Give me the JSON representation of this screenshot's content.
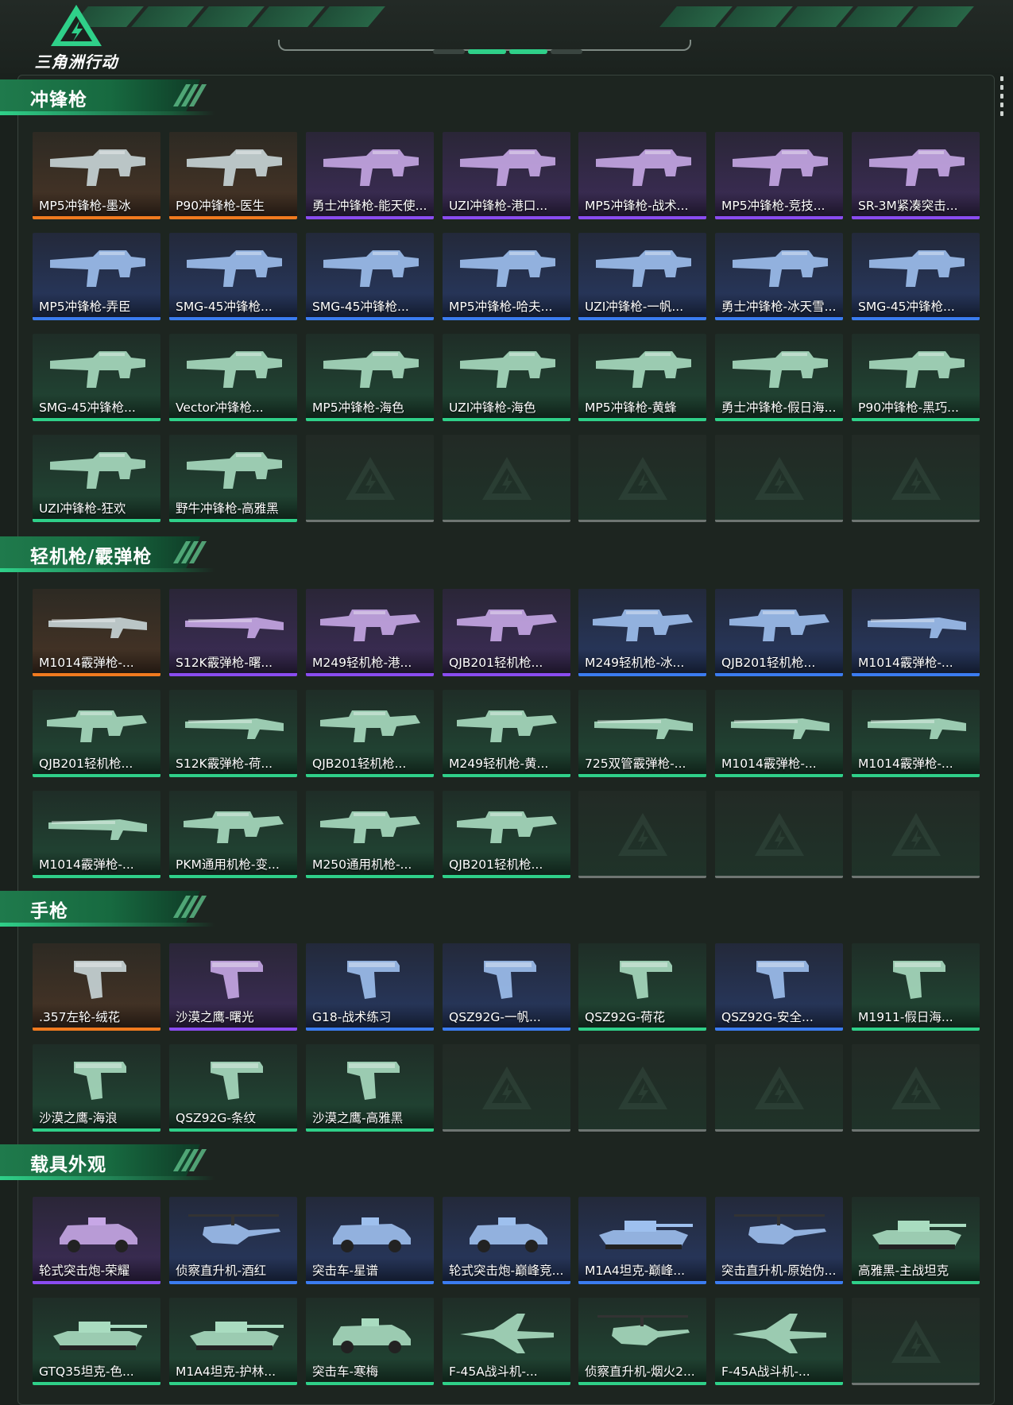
{
  "brand": {
    "name": "三角洲行动"
  },
  "colors": {
    "accent": "#2fd089",
    "orange": "#f07a1f",
    "purple": "#8a4cf0",
    "blue": "#3b7cf0",
    "green": "#2fd089"
  },
  "sections": [
    {
      "title": "冲锋枪",
      "items": [
        {
          "label": "MP5冲锋枪-墨冰",
          "rarity": "orange",
          "icon": "smg-icon"
        },
        {
          "label": "P90冲锋枪-医生",
          "rarity": "orange",
          "icon": "smg-icon"
        },
        {
          "label": "勇士冲锋枪-能天使...",
          "rarity": "purple",
          "icon": "smg-icon"
        },
        {
          "label": "UZI冲锋枪-港口...",
          "rarity": "purple",
          "icon": "smg-icon"
        },
        {
          "label": "MP5冲锋枪-战术...",
          "rarity": "purple",
          "icon": "smg-icon"
        },
        {
          "label": "MP5冲锋枪-竞技...",
          "rarity": "purple",
          "icon": "smg-icon"
        },
        {
          "label": "SR-3M紧凑突击...",
          "rarity": "purple",
          "icon": "smg-icon"
        },
        {
          "label": "MP5冲锋枪-弄臣",
          "rarity": "blue",
          "icon": "smg-icon"
        },
        {
          "label": "SMG-45冲锋枪...",
          "rarity": "blue",
          "icon": "smg-icon"
        },
        {
          "label": "SMG-45冲锋枪...",
          "rarity": "blue",
          "icon": "smg-icon"
        },
        {
          "label": "MP5冲锋枪-哈夫...",
          "rarity": "blue",
          "icon": "smg-icon"
        },
        {
          "label": "UZI冲锋枪-一帆...",
          "rarity": "blue",
          "icon": "smg-icon"
        },
        {
          "label": "勇士冲锋枪-冰天雪...",
          "rarity": "blue",
          "icon": "smg-icon"
        },
        {
          "label": "SMG-45冲锋枪...",
          "rarity": "blue",
          "icon": "smg-icon"
        },
        {
          "label": "SMG-45冲锋枪...",
          "rarity": "green",
          "icon": "smg-icon"
        },
        {
          "label": "Vector冲锋枪...",
          "rarity": "green",
          "icon": "smg-icon"
        },
        {
          "label": "MP5冲锋枪-海色",
          "rarity": "green",
          "icon": "smg-icon"
        },
        {
          "label": "UZI冲锋枪-海色",
          "rarity": "green",
          "icon": "smg-icon"
        },
        {
          "label": "MP5冲锋枪-黄蜂",
          "rarity": "green",
          "icon": "smg-icon"
        },
        {
          "label": "勇士冲锋枪-假日海...",
          "rarity": "green",
          "icon": "smg-icon"
        },
        {
          "label": "P90冲锋枪-黑巧...",
          "rarity": "green",
          "icon": "smg-icon"
        },
        {
          "label": "UZI冲锋枪-狂欢",
          "rarity": "green",
          "icon": "smg-icon"
        },
        {
          "label": "野牛冲锋枪-高雅黑",
          "rarity": "green",
          "icon": "smg-icon"
        },
        {
          "label": "",
          "rarity": "empty"
        },
        {
          "label": "",
          "rarity": "empty"
        },
        {
          "label": "",
          "rarity": "empty"
        },
        {
          "label": "",
          "rarity": "empty"
        },
        {
          "label": "",
          "rarity": "empty"
        }
      ]
    },
    {
      "title": "轻机枪/霰弹枪",
      "items": [
        {
          "label": "M1014霰弹枪-...",
          "rarity": "orange",
          "icon": "shotgun-icon"
        },
        {
          "label": "S12K霰弹枪-曙...",
          "rarity": "purple",
          "icon": "shotgun-icon"
        },
        {
          "label": "M249轻机枪-港...",
          "rarity": "purple",
          "icon": "lmg-icon"
        },
        {
          "label": "QJB201轻机枪...",
          "rarity": "purple",
          "icon": "lmg-icon"
        },
        {
          "label": "M249轻机枪-冰...",
          "rarity": "blue",
          "icon": "lmg-icon"
        },
        {
          "label": "QJB201轻机枪...",
          "rarity": "blue",
          "icon": "lmg-icon"
        },
        {
          "label": "M1014霰弹枪-...",
          "rarity": "blue",
          "icon": "shotgun-icon"
        },
        {
          "label": "QJB201轻机枪...",
          "rarity": "green",
          "icon": "lmg-icon"
        },
        {
          "label": "S12K霰弹枪-荷...",
          "rarity": "green",
          "icon": "shotgun-icon"
        },
        {
          "label": "QJB201轻机枪...",
          "rarity": "green",
          "icon": "lmg-icon"
        },
        {
          "label": "M249轻机枪-黄...",
          "rarity": "green",
          "icon": "lmg-icon"
        },
        {
          "label": "725双管霰弹枪-...",
          "rarity": "green",
          "icon": "shotgun-icon"
        },
        {
          "label": "M1014霰弹枪-...",
          "rarity": "green",
          "icon": "shotgun-icon"
        },
        {
          "label": "M1014霰弹枪-...",
          "rarity": "green",
          "icon": "shotgun-icon"
        },
        {
          "label": "M1014霰弹枪-...",
          "rarity": "green",
          "icon": "shotgun-icon"
        },
        {
          "label": "PKM通用机枪-变...",
          "rarity": "green",
          "icon": "lmg-icon"
        },
        {
          "label": "M250通用机枪-...",
          "rarity": "green",
          "icon": "lmg-icon"
        },
        {
          "label": "QJB201轻机枪...",
          "rarity": "green",
          "icon": "lmg-icon"
        },
        {
          "label": "",
          "rarity": "empty"
        },
        {
          "label": "",
          "rarity": "empty"
        },
        {
          "label": "",
          "rarity": "empty"
        }
      ]
    },
    {
      "title": "手枪",
      "items": [
        {
          "label": ".357左轮-绒花",
          "rarity": "orange",
          "icon": "pistol-icon"
        },
        {
          "label": "沙漠之鹰-曙光",
          "rarity": "purple",
          "icon": "pistol-icon"
        },
        {
          "label": "G18-战术练习",
          "rarity": "blue",
          "icon": "pistol-icon"
        },
        {
          "label": "QSZ92G-一帆...",
          "rarity": "blue",
          "icon": "pistol-icon"
        },
        {
          "label": "QSZ92G-荷花",
          "rarity": "green",
          "icon": "pistol-icon"
        },
        {
          "label": "QSZ92G-安全...",
          "rarity": "blue",
          "icon": "pistol-icon"
        },
        {
          "label": "M1911-假日海...",
          "rarity": "green",
          "icon": "pistol-icon"
        },
        {
          "label": "沙漠之鹰-海浪",
          "rarity": "green",
          "icon": "pistol-icon"
        },
        {
          "label": "QSZ92G-条纹",
          "rarity": "green",
          "icon": "pistol-icon"
        },
        {
          "label": "沙漠之鹰-高雅黑",
          "rarity": "green",
          "icon": "pistol-icon"
        },
        {
          "label": "",
          "rarity": "empty"
        },
        {
          "label": "",
          "rarity": "empty"
        },
        {
          "label": "",
          "rarity": "empty"
        },
        {
          "label": "",
          "rarity": "empty"
        }
      ]
    },
    {
      "title": "载具外观",
      "items": [
        {
          "label": "轮式突击炮-荣耀",
          "rarity": "purple",
          "icon": "vehicle-icon"
        },
        {
          "label": "侦察直升机-酒红",
          "rarity": "blue",
          "icon": "helicopter-icon"
        },
        {
          "label": "突击车-星谱",
          "rarity": "blue",
          "icon": "vehicle-icon"
        },
        {
          "label": "轮式突击炮-巅峰竞...",
          "rarity": "blue",
          "icon": "vehicle-icon"
        },
        {
          "label": "M1A4坦克-巅峰...",
          "rarity": "blue",
          "icon": "tank-icon"
        },
        {
          "label": "突击直升机-原始伪...",
          "rarity": "blue",
          "icon": "helicopter-icon"
        },
        {
          "label": "高雅黑-主战坦克",
          "rarity": "green",
          "icon": "tank-icon"
        },
        {
          "label": "GTQ35坦克-色...",
          "rarity": "green",
          "icon": "tank-icon"
        },
        {
          "label": "M1A4坦克-护林...",
          "rarity": "green",
          "icon": "tank-icon"
        },
        {
          "label": "突击车-寒梅",
          "rarity": "green",
          "icon": "vehicle-icon"
        },
        {
          "label": "F-45A战斗机-...",
          "rarity": "green",
          "icon": "jet-icon"
        },
        {
          "label": "侦察直升机-烟火2...",
          "rarity": "green",
          "icon": "helicopter-icon"
        },
        {
          "label": "F-45A战斗机-...",
          "rarity": "green",
          "icon": "jet-icon"
        },
        {
          "label": "",
          "rarity": "empty"
        }
      ]
    }
  ]
}
